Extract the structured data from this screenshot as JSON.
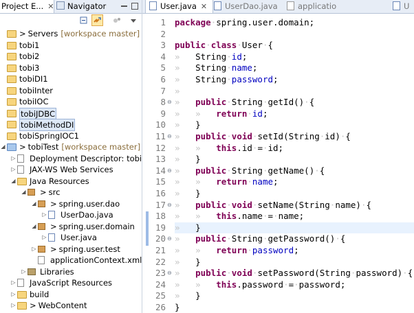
{
  "left_tabs": {
    "project_explorer": "Project E...",
    "navigator": "Navigator",
    "close": "✕"
  },
  "toolbar": {
    "collapse_all": "collapse-all-icon",
    "link_editor": "link-editor-icon",
    "view_menu": "view-menu-icon"
  },
  "tree": [
    {
      "label": "Servers",
      "deco": "[workspace master]",
      "icon": "folder",
      "depth": 0,
      "arrow": "",
      "prefix": ">"
    },
    {
      "label": "tobi1",
      "icon": "folder",
      "depth": 0
    },
    {
      "label": "tobi2",
      "icon": "folder",
      "depth": 0
    },
    {
      "label": "tobi3",
      "icon": "folder",
      "depth": 0
    },
    {
      "label": "tobiDI1",
      "icon": "folder",
      "depth": 0
    },
    {
      "label": "tobiInter",
      "icon": "folder",
      "depth": 0
    },
    {
      "label": "tobiIOC",
      "icon": "folder",
      "depth": 0
    },
    {
      "label": "tobiJDBC",
      "icon": "folder",
      "depth": 0,
      "selected": true
    },
    {
      "label": "tobiMethodDI",
      "icon": "folder",
      "depth": 0,
      "selected": true
    },
    {
      "label": "tobiSpringIOC1",
      "icon": "folder",
      "depth": 0
    },
    {
      "label": "tobiTest",
      "deco": "[workspace master]",
      "icon": "proj",
      "depth": 0,
      "arrow": "◢",
      "prefix": ">"
    },
    {
      "label": "Deployment Descriptor: tobiTest",
      "icon": "xfile",
      "depth": 1,
      "arrow": "▷"
    },
    {
      "label": "JAX-WS Web Services",
      "icon": "xfile",
      "depth": 1,
      "arrow": "▷"
    },
    {
      "label": "Java Resources",
      "icon": "folder",
      "depth": 1,
      "arrow": "◢"
    },
    {
      "label": "src",
      "icon": "pkg",
      "depth": 2,
      "arrow": "◢",
      "prefix": ">"
    },
    {
      "label": "spring.user.dao",
      "icon": "pkg",
      "depth": 3,
      "arrow": "◢",
      "prefix": ">"
    },
    {
      "label": "UserDao.java",
      "icon": "jfile",
      "depth": 4,
      "arrow": "▷"
    },
    {
      "label": "spring.user.domain",
      "icon": "pkg",
      "depth": 3,
      "arrow": "◢",
      "prefix": ">"
    },
    {
      "label": "User.java",
      "icon": "jfile",
      "depth": 4,
      "arrow": "▷"
    },
    {
      "label": "spring.user.test",
      "icon": "pkg",
      "depth": 3,
      "arrow": "▷",
      "prefix": ">"
    },
    {
      "label": "applicationContext.xml",
      "icon": "xfile",
      "depth": 3
    },
    {
      "label": "Libraries",
      "icon": "lib",
      "depth": 2,
      "arrow": "▷"
    },
    {
      "label": "JavaScript Resources",
      "icon": "xfile",
      "depth": 1,
      "arrow": "▷"
    },
    {
      "label": "build",
      "icon": "folder",
      "depth": 1,
      "arrow": "▷"
    },
    {
      "label": "WebContent",
      "icon": "folder",
      "depth": 1,
      "arrow": "▷",
      "prefix": ">"
    }
  ],
  "editor_tabs": [
    {
      "label": "User.java",
      "active": true,
      "close": "✕"
    },
    {
      "label": "UserDao.java"
    },
    {
      "label": "applicatio"
    },
    {
      "label": "U"
    }
  ],
  "code": [
    {
      "n": "1",
      "fold": "",
      "segs": [
        [
          "kw",
          "package"
        ],
        [
          "ws",
          "·"
        ],
        [
          "",
          "spring.user.domain;"
        ]
      ]
    },
    {
      "n": "2",
      "fold": "",
      "segs": []
    },
    {
      "n": "3",
      "fold": "",
      "segs": [
        [
          "kw",
          "public"
        ],
        [
          "ws",
          "·"
        ],
        [
          "kw",
          "class"
        ],
        [
          "ws",
          "·"
        ],
        [
          "",
          "User"
        ],
        [
          "ws",
          "·"
        ],
        [
          "",
          "{"
        ]
      ]
    },
    {
      "n": "4",
      "fold": "",
      "segs": [
        [
          "ws",
          "»   "
        ],
        [
          "",
          "String"
        ],
        [
          "ws",
          "·"
        ],
        [
          "fd",
          "id"
        ],
        [
          "",
          ";"
        ]
      ]
    },
    {
      "n": "5",
      "fold": "",
      "segs": [
        [
          "ws",
          "»   "
        ],
        [
          "",
          "String"
        ],
        [
          "ws",
          "·"
        ],
        [
          "fd",
          "name"
        ],
        [
          "",
          ";"
        ]
      ]
    },
    {
      "n": "6",
      "fold": "",
      "segs": [
        [
          "ws",
          "»   "
        ],
        [
          "",
          "String"
        ],
        [
          "ws",
          "·"
        ],
        [
          "fd",
          "password"
        ],
        [
          "",
          ";"
        ]
      ]
    },
    {
      "n": "7",
      "fold": "",
      "segs": [
        [
          "ws",
          "»   "
        ]
      ]
    },
    {
      "n": "8",
      "fold": "⊖",
      "segs": [
        [
          "ws",
          "»   "
        ],
        [
          "kw",
          "public"
        ],
        [
          "ws",
          "·"
        ],
        [
          "",
          "String"
        ],
        [
          "ws",
          "·"
        ],
        [
          "",
          "getId()"
        ],
        [
          "ws",
          "·"
        ],
        [
          "",
          "{"
        ]
      ]
    },
    {
      "n": "9",
      "fold": "",
      "segs": [
        [
          "ws",
          "»   »   "
        ],
        [
          "kw",
          "return"
        ],
        [
          "ws",
          "·"
        ],
        [
          "fd",
          "id"
        ],
        [
          "",
          ";"
        ]
      ]
    },
    {
      "n": "10",
      "fold": "",
      "segs": [
        [
          "ws",
          "»   "
        ],
        [
          "",
          "}"
        ]
      ]
    },
    {
      "n": "11",
      "fold": "⊖",
      "segs": [
        [
          "ws",
          "»   "
        ],
        [
          "kw",
          "public"
        ],
        [
          "ws",
          "·"
        ],
        [
          "kw",
          "void"
        ],
        [
          "ws",
          "·"
        ],
        [
          "",
          "setId(String"
        ],
        [
          "ws",
          "·"
        ],
        [
          "",
          "id)"
        ],
        [
          "ws",
          "·"
        ],
        [
          "",
          "{"
        ]
      ]
    },
    {
      "n": "12",
      "fold": "",
      "segs": [
        [
          "ws",
          "»   »   "
        ],
        [
          "kw",
          "this"
        ],
        [
          "",
          ".id"
        ],
        [
          "ws",
          "·"
        ],
        [
          "",
          "="
        ],
        [
          "ws",
          "·"
        ],
        [
          "",
          "id;"
        ]
      ]
    },
    {
      "n": "13",
      "fold": "",
      "segs": [
        [
          "ws",
          "»   "
        ],
        [
          "",
          "}"
        ]
      ]
    },
    {
      "n": "14",
      "fold": "⊖",
      "segs": [
        [
          "ws",
          "»   "
        ],
        [
          "kw",
          "public"
        ],
        [
          "ws",
          "·"
        ],
        [
          "",
          "String"
        ],
        [
          "ws",
          "·"
        ],
        [
          "",
          "getName()"
        ],
        [
          "ws",
          "·"
        ],
        [
          "",
          "{"
        ]
      ]
    },
    {
      "n": "15",
      "fold": "",
      "segs": [
        [
          "ws",
          "»   »   "
        ],
        [
          "kw",
          "return"
        ],
        [
          "ws",
          "·"
        ],
        [
          "fd",
          "name"
        ],
        [
          "",
          ";"
        ]
      ]
    },
    {
      "n": "16",
      "fold": "",
      "segs": [
        [
          "ws",
          "»   "
        ],
        [
          "",
          "}"
        ]
      ]
    },
    {
      "n": "17",
      "fold": "⊖",
      "segs": [
        [
          "ws",
          "»   "
        ],
        [
          "kw",
          "public"
        ],
        [
          "ws",
          "·"
        ],
        [
          "kw",
          "void"
        ],
        [
          "ws",
          "·"
        ],
        [
          "",
          "setName(String"
        ],
        [
          "ws",
          "·"
        ],
        [
          "",
          "name)"
        ],
        [
          "ws",
          "·"
        ],
        [
          "",
          "{"
        ]
      ]
    },
    {
      "n": "18",
      "fold": "",
      "segs": [
        [
          "ws",
          "»   »   "
        ],
        [
          "kw",
          "this"
        ],
        [
          "",
          ".name"
        ],
        [
          "ws",
          "·"
        ],
        [
          "",
          "="
        ],
        [
          "ws",
          "·"
        ],
        [
          "",
          "name;"
        ]
      ]
    },
    {
      "n": "19",
      "fold": "",
      "cur": true,
      "segs": [
        [
          "ws",
          "»   "
        ],
        [
          "",
          "}"
        ]
      ]
    },
    {
      "n": "20",
      "fold": "⊖",
      "segs": [
        [
          "ws",
          "»   "
        ],
        [
          "kw",
          "public"
        ],
        [
          "ws",
          "·"
        ],
        [
          "",
          "String"
        ],
        [
          "ws",
          "·"
        ],
        [
          "",
          "getPassword()"
        ],
        [
          "ws",
          "·"
        ],
        [
          "",
          "{"
        ]
      ]
    },
    {
      "n": "21",
      "fold": "",
      "segs": [
        [
          "ws",
          "»   »   "
        ],
        [
          "kw",
          "return"
        ],
        [
          "ws",
          "·"
        ],
        [
          "fd",
          "password"
        ],
        [
          "",
          ";"
        ]
      ]
    },
    {
      "n": "22",
      "fold": "",
      "segs": [
        [
          "ws",
          "»   "
        ],
        [
          "",
          "}"
        ]
      ]
    },
    {
      "n": "23",
      "fold": "⊖",
      "segs": [
        [
          "ws",
          "»   "
        ],
        [
          "kw",
          "public"
        ],
        [
          "ws",
          "·"
        ],
        [
          "kw",
          "void"
        ],
        [
          "ws",
          "·"
        ],
        [
          "",
          "setPassword(String"
        ],
        [
          "ws",
          "·"
        ],
        [
          "",
          "password)"
        ],
        [
          "ws",
          "·"
        ],
        [
          "",
          "{"
        ]
      ]
    },
    {
      "n": "24",
      "fold": "",
      "segs": [
        [
          "ws",
          "»   »   "
        ],
        [
          "kw",
          "this"
        ],
        [
          "",
          ".password"
        ],
        [
          "ws",
          "·"
        ],
        [
          "",
          "="
        ],
        [
          "ws",
          "·"
        ],
        [
          "",
          "password;"
        ]
      ]
    },
    {
      "n": "25",
      "fold": "",
      "segs": [
        [
          "ws",
          "»   "
        ],
        [
          "",
          "}"
        ]
      ]
    },
    {
      "n": "26",
      "fold": "",
      "segs": [
        [
          "",
          "}"
        ]
      ]
    }
  ]
}
